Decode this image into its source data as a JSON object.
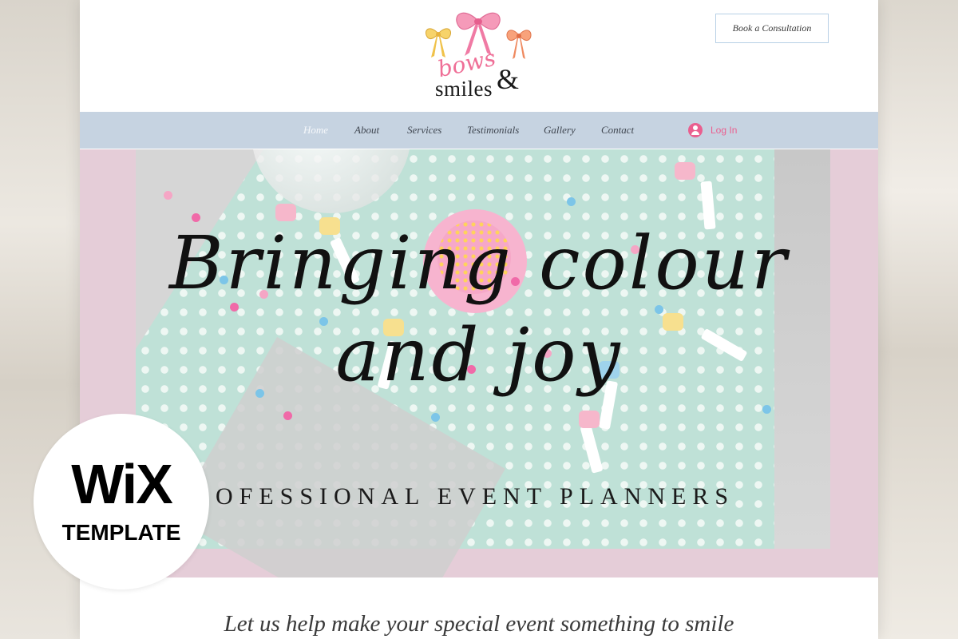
{
  "logo": {
    "line1": "bows",
    "line2": "smiles",
    "ampersand": "&"
  },
  "header": {
    "cta_label": "Book a Consultation"
  },
  "nav": {
    "items": [
      "Home",
      "About",
      "Services",
      "Testimonials",
      "Gallery",
      "Contact"
    ],
    "active": "Home",
    "login_label": "Log In"
  },
  "hero": {
    "title_line1": "Bringing colour",
    "title_line2": "and joy",
    "subtitle": "OFESSIONAL EVENT PLANNERS"
  },
  "tagline": "Let us help make your special event something to smile",
  "badge": {
    "word": "WiX",
    "sub": "TEMPLATE"
  },
  "colors": {
    "accent_pink": "#ea5f8f",
    "nav_bg": "#c6d3e1",
    "hero_mint": "#bfe1d7",
    "hero_pink": "#e5cdd8"
  },
  "icons": {
    "login": "user-avatar-icon",
    "logo_bows": "bow-icon"
  }
}
